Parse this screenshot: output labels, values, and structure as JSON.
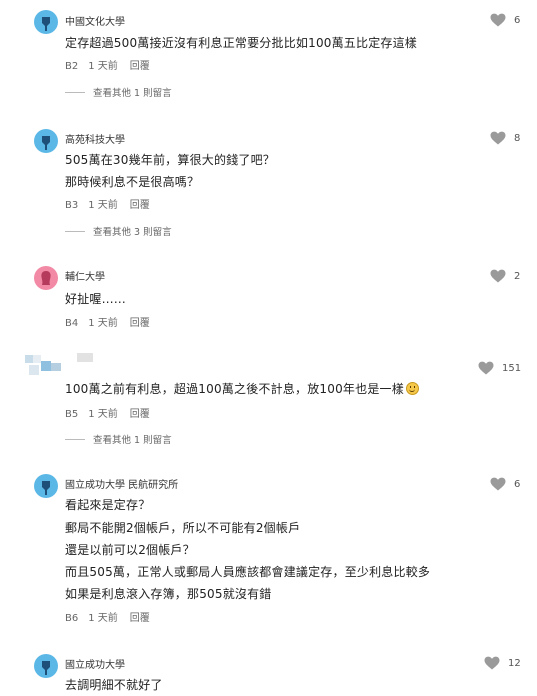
{
  "comments": [
    {
      "author": "中國文化大學",
      "lines": [
        "定存超過500萬接近沒有利息正常要分批比如100萬五比定存這樣"
      ],
      "floor": "B2",
      "time": "1 天前",
      "reply": "回覆",
      "likes": "6",
      "more": "查看其他 1 則留言"
    },
    {
      "author": "高苑科技大學",
      "lines": [
        "505萬在30幾年前，算很大的錢了吧？",
        "那時候利息不是很高嗎？"
      ],
      "floor": "B3",
      "time": "1 天前",
      "reply": "回覆",
      "likes": "8",
      "more": "查看其他 3 則留言"
    },
    {
      "author": "輔仁大學",
      "lines": [
        "好扯喔……"
      ],
      "floor": "B4",
      "time": "1 天前",
      "reply": "回覆",
      "likes": "2"
    },
    {
      "author": "",
      "lines": [
        "100萬之前有利息，超過100萬之後不計息，放100年也是一樣"
      ],
      "floor": "B5",
      "time": "1 天前",
      "reply": "回覆",
      "likes": "151",
      "more": "查看其他 1 則留言"
    },
    {
      "author": "國立成功大學 民航研究所",
      "lines": [
        "看起來是定存？",
        "郵局不能開2個帳戶，所以不可能有2個帳戶",
        "還是以前可以2個帳戶？",
        "而且505萬，正常人或郵局人員應該都會建議定存，至少利息比較多",
        "如果是利息滾入存簿，那505就沒有錯"
      ],
      "floor": "B6",
      "time": "1 天前",
      "reply": "回覆",
      "likes": "6"
    },
    {
      "author": "國立成功大學",
      "lines": [
        "去調明細不就好了"
      ],
      "likes": "12"
    }
  ],
  "icons": {
    "like": "heart-icon",
    "avatar": "user-avatar-icon",
    "emoji": "smile-emoji-icon"
  },
  "colors": {
    "avatar_blue": "#5bb8e6",
    "avatar_pink": "#f28aa6",
    "heart": "#9a9a9a"
  }
}
